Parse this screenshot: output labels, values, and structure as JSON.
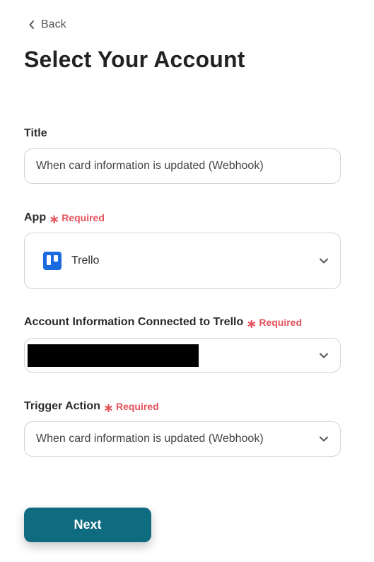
{
  "nav": {
    "back_label": "Back"
  },
  "page": {
    "title": "Select Your Account"
  },
  "form": {
    "title_field": {
      "label": "Title",
      "value": "When card information is updated (Webhook)"
    },
    "app_field": {
      "label": "App",
      "required": "Required",
      "value": "Trello",
      "icon": "trello-icon"
    },
    "account_field": {
      "label": "Account Information Connected to Trello",
      "required": "Required",
      "value_redacted": true
    },
    "trigger_field": {
      "label": "Trigger Action",
      "required": "Required",
      "value": "When card information is updated (Webhook)"
    }
  },
  "actions": {
    "next_label": "Next"
  },
  "colors": {
    "required": "#e5515b",
    "primary_button": "#0f6b80",
    "trello_blue": "#1a6ae0"
  }
}
